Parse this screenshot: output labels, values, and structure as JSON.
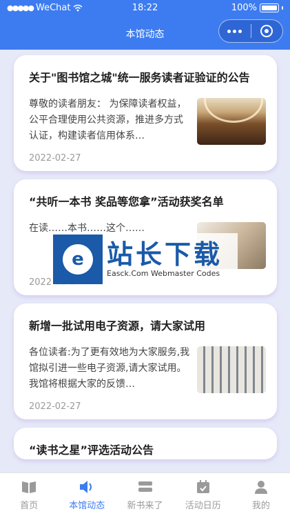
{
  "status_bar": {
    "carrier": "WeChat",
    "time": "18:22",
    "battery": "100%"
  },
  "nav": {
    "title": "本馆动态"
  },
  "articles": [
    {
      "title": "关于\"图书馆之城\"统一服务读者证验证的公告",
      "excerpt": "尊敬的读者朋友： 为保障读者权益，公平合理使用公共资源，推进多方式认证，构建读者信用体系…",
      "date": "2022-02-27"
    },
    {
      "title": "“共听一本书 奖品等您拿”活动获奖名单",
      "excerpt": "在读……本书……这个……",
      "date": "2022-02-27"
    },
    {
      "title": "新增一批试用电子资源，请大家试用",
      "excerpt": "各位读者:为了更有效地为大家服务,我馆拟引进一些电子资源,请大家试用。我馆将根据大家的反馈…",
      "date": "2022-02-27"
    },
    {
      "title": "“读书之星”评选活动公告",
      "excerpt": "",
      "date": ""
    }
  ],
  "watermark": {
    "cn": "站长下载",
    "en": "Easck.Com Webmaster Codes"
  },
  "tabs": [
    {
      "label": "首页",
      "icon": "book-icon",
      "active": false
    },
    {
      "label": "本馆动态",
      "icon": "speaker-icon",
      "active": true
    },
    {
      "label": "新书来了",
      "icon": "stack-icon",
      "active": false
    },
    {
      "label": "活动日历",
      "icon": "calendar-check-icon",
      "active": false
    },
    {
      "label": "我的",
      "icon": "person-icon",
      "active": false
    }
  ],
  "colors": {
    "primary": "#3d7cf0",
    "inactive": "#9a9a9a",
    "background": "#e6e9f8"
  }
}
